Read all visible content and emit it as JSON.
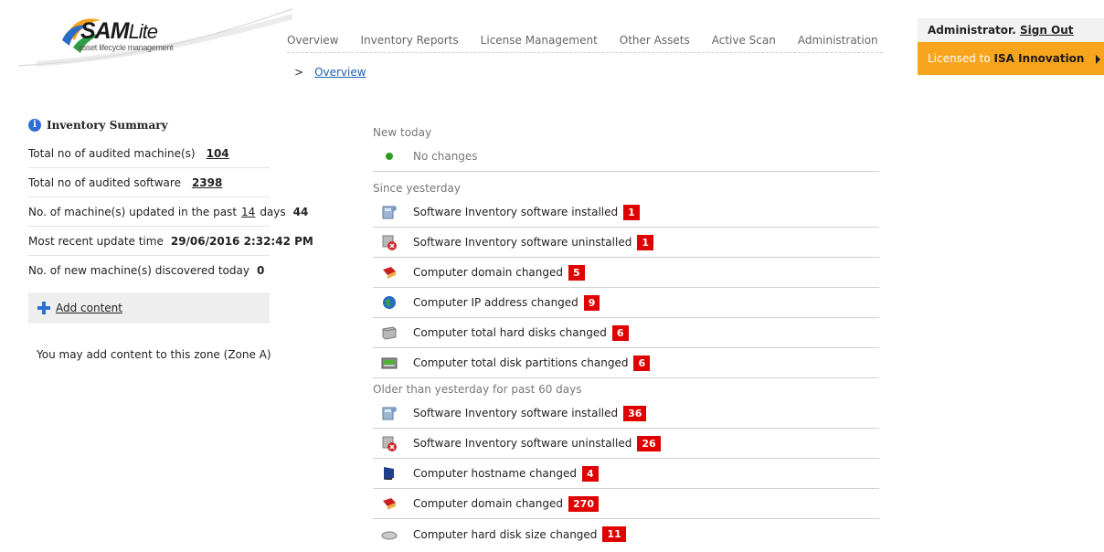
{
  "logo": {
    "brand": "SAM",
    "brand_suffix": "Lite",
    "tagline": "asset lifecycle management"
  },
  "nav": {
    "items": [
      "Overview",
      "Inventory Reports",
      "License Management",
      "Other Assets",
      "Active Scan",
      "Administration"
    ]
  },
  "breadcrumb": {
    "separator": ">",
    "current": "Overview"
  },
  "account": {
    "user": "Administrator.",
    "sign_out": "Sign Out",
    "license_prefix": "Licensed to",
    "license_org": "ISA Innovation"
  },
  "summary": {
    "title": "Inventory Summary",
    "audited_machines_label": "Total no of audited machine(s)",
    "audited_machines_value": "104",
    "audited_software_label": "Total no of audited software",
    "audited_software_value": "2398",
    "updated_prefix": "No. of machine(s) updated in the past",
    "updated_days": "14",
    "updated_suffix": "days",
    "updated_value": "44",
    "recent_update_label": "Most recent update time",
    "recent_update_value": "29/06/2016 2:32:42 PM",
    "new_machines_label": "No. of new machine(s) discovered today",
    "new_machines_value": "0"
  },
  "add_content": {
    "label": "Add content",
    "zone_text": "You may add content to this zone (Zone A)"
  },
  "feed": {
    "new_today": {
      "title": "New today",
      "items": [
        {
          "label": "No changes",
          "icon": "green-dot-icon"
        }
      ]
    },
    "since_yesterday": {
      "title": "Since yesterday",
      "items": [
        {
          "label": "Software Inventory software installed",
          "count": "1",
          "icon": "software-installed-icon"
        },
        {
          "label": "Software Inventory software uninstalled",
          "count": "1",
          "icon": "software-uninstalled-icon"
        },
        {
          "label": "Computer domain changed",
          "count": "5",
          "icon": "domain-icon"
        },
        {
          "label": "Computer IP address changed",
          "count": "9",
          "icon": "globe-icon"
        },
        {
          "label": "Computer total hard disks changed",
          "count": "6",
          "icon": "hard-disk-icon"
        },
        {
          "label": "Computer total disk partitions changed",
          "count": "6",
          "icon": "disk-partition-icon"
        }
      ]
    },
    "older": {
      "title": "Older than yesterday for past 60 days",
      "items": [
        {
          "label": "Software Inventory software installed",
          "count": "36",
          "icon": "software-installed-icon"
        },
        {
          "label": "Software Inventory software uninstalled",
          "count": "26",
          "icon": "software-uninstalled-icon"
        },
        {
          "label": "Computer hostname changed",
          "count": "4",
          "icon": "monitor-icon"
        },
        {
          "label": "Computer domain changed",
          "count": "270",
          "icon": "domain-icon"
        },
        {
          "label": "Computer hard disk size changed",
          "count": "11",
          "icon": "disk-size-icon"
        }
      ]
    }
  }
}
